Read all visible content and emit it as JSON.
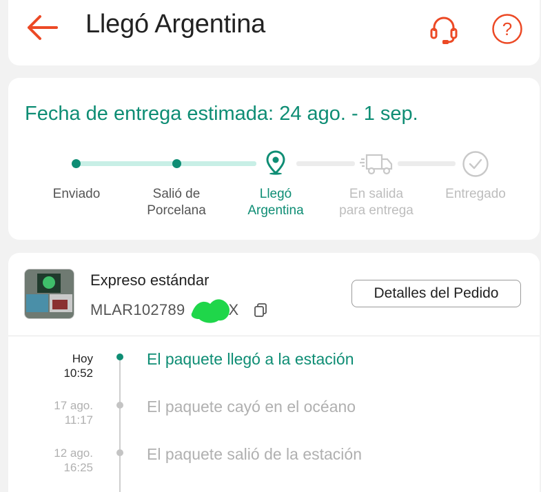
{
  "header": {
    "title": "Llegó Argentina",
    "accent_color": "#ec4925"
  },
  "delivery": {
    "eta_label": "Fecha de entrega estimada:",
    "eta_range": "24 ago. - 1 sep.",
    "accent_color": "#0e8d74",
    "steps": [
      {
        "line1": "Enviado",
        "line2": "",
        "state": "done"
      },
      {
        "line1": "Salió de",
        "line2": "Porcelana",
        "state": "done"
      },
      {
        "line1": "Llegó",
        "line2": "Argentina",
        "state": "current",
        "icon": "location-pin-icon"
      },
      {
        "line1": "En salida",
        "line2": "para entrega",
        "state": "pending",
        "icon": "delivery-truck-icon"
      },
      {
        "line1": "Entregado",
        "line2": "",
        "state": "pending",
        "icon": "check-circle-icon"
      }
    ]
  },
  "order": {
    "shipping_method": "Expreso estándar",
    "tracking_code_prefix": "MLAR102789",
    "tracking_code_suffix": "EX",
    "details_button": "Detalles del Pedido"
  },
  "events": [
    {
      "date": "Hoy",
      "time": "10:52",
      "description": "El paquete llegó a la estación",
      "active": true
    },
    {
      "date": "17 ago.",
      "time": "11:17",
      "description": "El paquete cayó en el océano",
      "active": false
    },
    {
      "date": "12 ago.",
      "time": "16:25",
      "description": "El paquete salió de la estación",
      "active": false
    }
  ]
}
